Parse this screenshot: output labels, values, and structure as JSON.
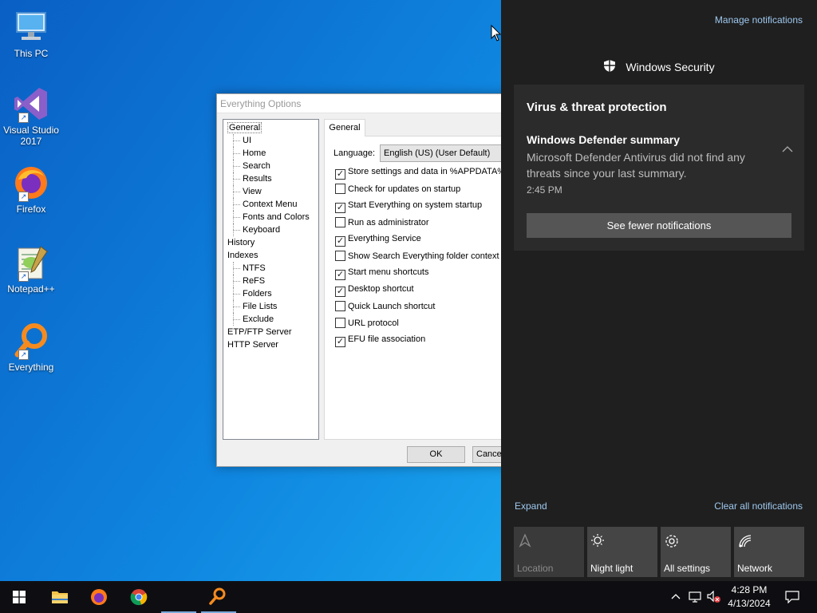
{
  "desktop": {
    "icons": [
      {
        "label_l1": "This PC",
        "label_l2": ""
      },
      {
        "label_l1": "Visual Studio",
        "label_l2": "2017"
      },
      {
        "label_l1": "Firefox",
        "label_l2": ""
      },
      {
        "label_l1": "Notepad++",
        "label_l2": ""
      },
      {
        "label_l1": "Everything",
        "label_l2": ""
      }
    ]
  },
  "dialog": {
    "title": "Everything Options",
    "tree": [
      "General",
      "UI",
      "Home",
      "Search",
      "Results",
      "View",
      "Context Menu",
      "Fonts and Colors",
      "Keyboard",
      "History",
      "Indexes",
      "NTFS",
      "ReFS",
      "Folders",
      "File Lists",
      "Exclude",
      "ETP/FTP Server",
      "HTTP Server"
    ],
    "tab": "General",
    "language_label": "Language:",
    "language_value": "English (US) (User Default)",
    "options": [
      {
        "label": "Store settings and data in %APPDATA%",
        "checked": true
      },
      {
        "label": "Check for updates on startup",
        "checked": false
      },
      {
        "label": "Start Everything on system startup",
        "checked": true
      },
      {
        "label": "Run as administrator",
        "checked": false
      },
      {
        "label": "Everything Service",
        "checked": true
      },
      {
        "label": "Show Search Everything folder context menu",
        "checked": false
      },
      {
        "label": "Start menu shortcuts",
        "checked": true
      },
      {
        "label": "Desktop shortcut",
        "checked": true
      },
      {
        "label": "Quick Launch shortcut",
        "checked": false
      },
      {
        "label": "URL protocol",
        "checked": false
      },
      {
        "label": "EFU file association",
        "checked": true
      }
    ],
    "ok_label": "OK",
    "cancel_label": "Cancel"
  },
  "action_center": {
    "manage": "Manage notifications",
    "app_name": "Windows Security",
    "group_title": "Virus & threat protection",
    "notif_title": "Windows Defender summary",
    "notif_body": "Microsoft Defender Antivirus did not find any threats since your last summary.",
    "notif_time": "2:45 PM",
    "fewer_label": "See fewer notifications",
    "expand": "Expand",
    "clear": "Clear all notifications",
    "tiles": [
      "Location",
      "Night light",
      "All settings",
      "Network"
    ]
  },
  "taskbar": {
    "time": "4:28 PM",
    "date": "4/13/2024"
  },
  "colors": {
    "accent_link": "#9ec9ef",
    "desktop_blue": "#0f86e0",
    "action_center_bg": "#1f1f1f"
  }
}
